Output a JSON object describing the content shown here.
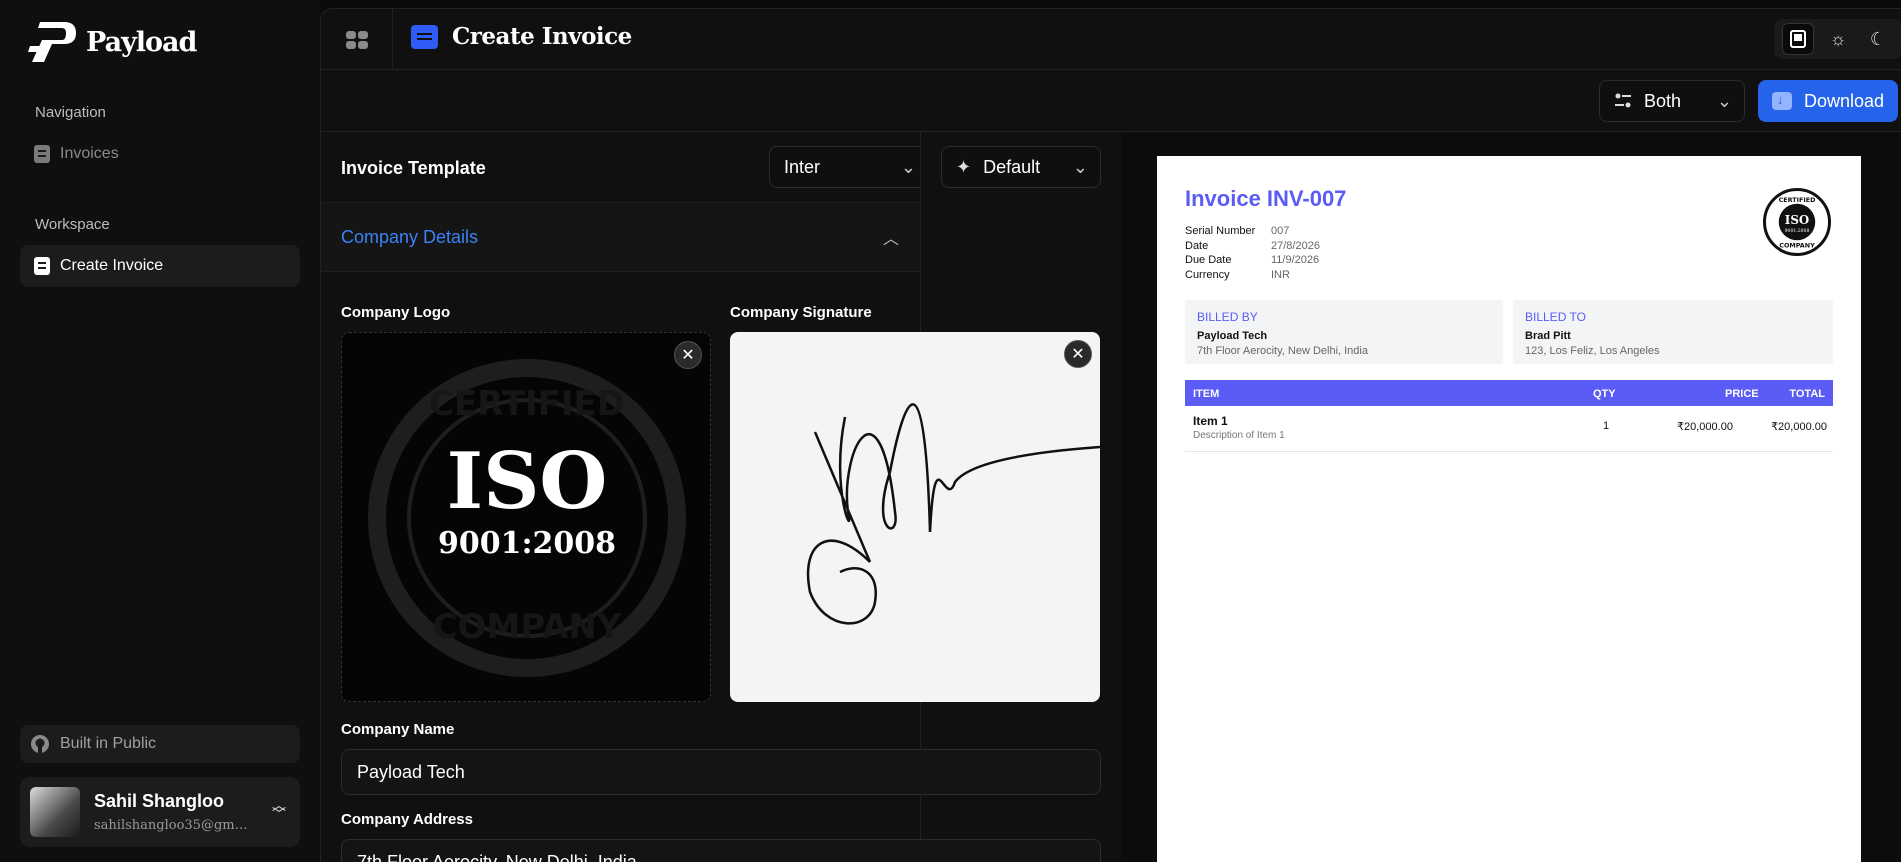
{
  "sidebar": {
    "brand": "Payload",
    "nav_title": "Navigation",
    "nav_items": [
      {
        "label": "Invoices"
      }
    ],
    "workspace_title": "Workspace",
    "workspace_items": [
      {
        "label": "Create Invoice"
      }
    ],
    "built_label": "Built in Public",
    "user": {
      "name": "Sahil Shangloo",
      "email": "sahilshangloo35@gmail..."
    }
  },
  "header": {
    "title": "Create Invoice",
    "view_select": "Both",
    "download_label": "Download"
  },
  "form": {
    "template_title": "Invoice Template",
    "font_select": "Inter",
    "theme_select": "Default",
    "section_title": "Company Details",
    "logo_label": "Company Logo",
    "signature_label": "Company Signature",
    "logo_text_main": "ISO",
    "logo_text_sub": "9001:2008",
    "logo_ring_top": "CERTIFIED",
    "logo_ring_bottom": "COMPANY",
    "name_label": "Company Name",
    "name_value": "Payload Tech",
    "address_label": "Company Address",
    "address_value": "7th Floor Aerocity, New Delhi, India"
  },
  "invoice": {
    "title": "Invoice INV-007",
    "meta": [
      {
        "key": "Serial Number",
        "value": "007"
      },
      {
        "key": "Date",
        "value": "27/8/2026"
      },
      {
        "key": "Due Date",
        "value": "11/9/2026"
      },
      {
        "key": "Currency",
        "value": "INR"
      }
    ],
    "badge_top": "CERTIFIED",
    "badge_main": "ISO",
    "badge_sub": "9001:2008",
    "badge_bottom": "COMPANY",
    "billed_by": {
      "heading": "BILLED BY",
      "name": "Payload Tech",
      "address": "7th Floor Aerocity, New Delhi, India"
    },
    "billed_to": {
      "heading": "BILLED TO",
      "name": "Brad Pitt",
      "address": "123, Los Feliz, Los Angeles"
    },
    "columns": {
      "item": "ITEM",
      "qty": "QTY",
      "price": "PRICE",
      "total": "TOTAL"
    },
    "rows": [
      {
        "name": "Item 1",
        "desc": "Description of Item 1",
        "qty": "1",
        "price": "₹20,000.00",
        "total": "₹20,000.00"
      }
    ]
  },
  "colors": {
    "accent": "#2563eb",
    "invoice_accent": "#5b5bf6",
    "link": "#3b82f6"
  },
  "icons": [
    "logo-icon",
    "document-icon",
    "github-icon",
    "chevron-updown-icon",
    "sidebar-toggle-icon",
    "invoice-icon",
    "monitor-icon",
    "sun-icon",
    "moon-icon",
    "view-icon",
    "download-icon",
    "sparkle-icon",
    "chevron-down-icon",
    "chevron-up-icon",
    "close-icon"
  ]
}
